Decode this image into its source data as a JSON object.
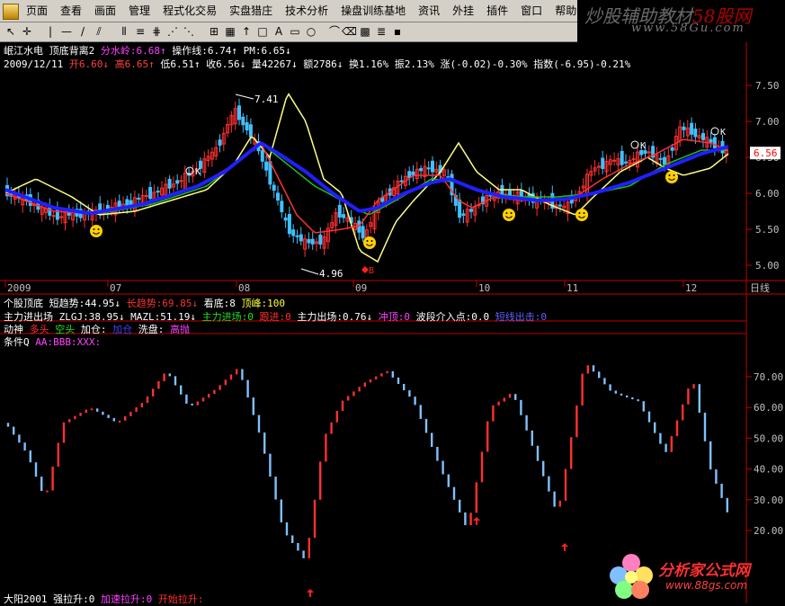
{
  "menu": [
    "页面",
    "查看",
    "画面",
    "管理",
    "程式化交易",
    "实盘猎庄",
    "技术分析",
    "操盘训练基地",
    "资讯",
    "外挂",
    "插件",
    "窗口",
    "帮助"
  ],
  "brand": {
    "text1": "炒股辅助教材",
    "text2": "58股网",
    "url": "www.58Gu.com"
  },
  "header": {
    "stock_name": "岷江水电",
    "indicator1": "顶底背离2",
    "label_fsm": "分水岭:6.68↑",
    "label_czx": "操作线:6.74↑",
    "label_pm": "PM:6.65↓",
    "date": "2009/12/11",
    "open": "开6.60↓",
    "high": "高6.65↑",
    "low": "低6.51↑",
    "close": "收6.56↓",
    "vol": "量42267↓",
    "amt": "额2786↓",
    "turnover": "换1.16%",
    "amp": "振2.13%",
    "change": "涨(-0.02)-0.30%",
    "index": "指数(-6.95)-0.21%"
  },
  "price_axis": {
    "labels": [
      "7.50",
      "7.00",
      "6.50",
      "6.00",
      "5.50",
      "5.00"
    ],
    "current": "6.56"
  },
  "x_axis": {
    "labels": [
      "2009",
      "07",
      "08",
      "09",
      "10",
      "11",
      "12"
    ],
    "period": "日线"
  },
  "annotations": {
    "high": "7.41",
    "low": "4.96",
    "k1": "K",
    "k2": "K",
    "k3": "K",
    "b": "B"
  },
  "panel2": {
    "row1": [
      "个股顶底",
      "短趋势:44.95↓",
      "长趋势:69.85↓",
      "看底:8",
      "顶峰:100"
    ],
    "row2": [
      "主力进出场",
      "ZLGJ:38.95↓",
      "MAZL:51.19↓",
      "主力进场:0",
      "跟进:0",
      "主力出场:0.76↓",
      "冲顶:0",
      "波段介入点:0.0",
      "短线出击:0"
    ],
    "row3": [
      "动神",
      "多头",
      "空头",
      "加仓:",
      "加仓",
      "洗盘:",
      "高抛"
    ],
    "row4": [
      "条件Q",
      "AA:BBB:XXX:"
    ],
    "axis": [
      "70.00",
      "60.00",
      "50.00",
      "40.00",
      "30.00",
      "20.00"
    ],
    "footer": [
      "大阳2001",
      "强拉升:0",
      "加速拉升:0",
      "开始拉升:"
    ]
  },
  "watermark": {
    "name": "分析家公式网",
    "url": "www.88gs.com"
  },
  "colors": {
    "up": "#ff3030",
    "down": "#40c0ff",
    "fsm": "#ffff80",
    "czx": "#ff3030",
    "pm": "#2020ff",
    "green": "#20c020",
    "axis": "#c00000"
  }
}
